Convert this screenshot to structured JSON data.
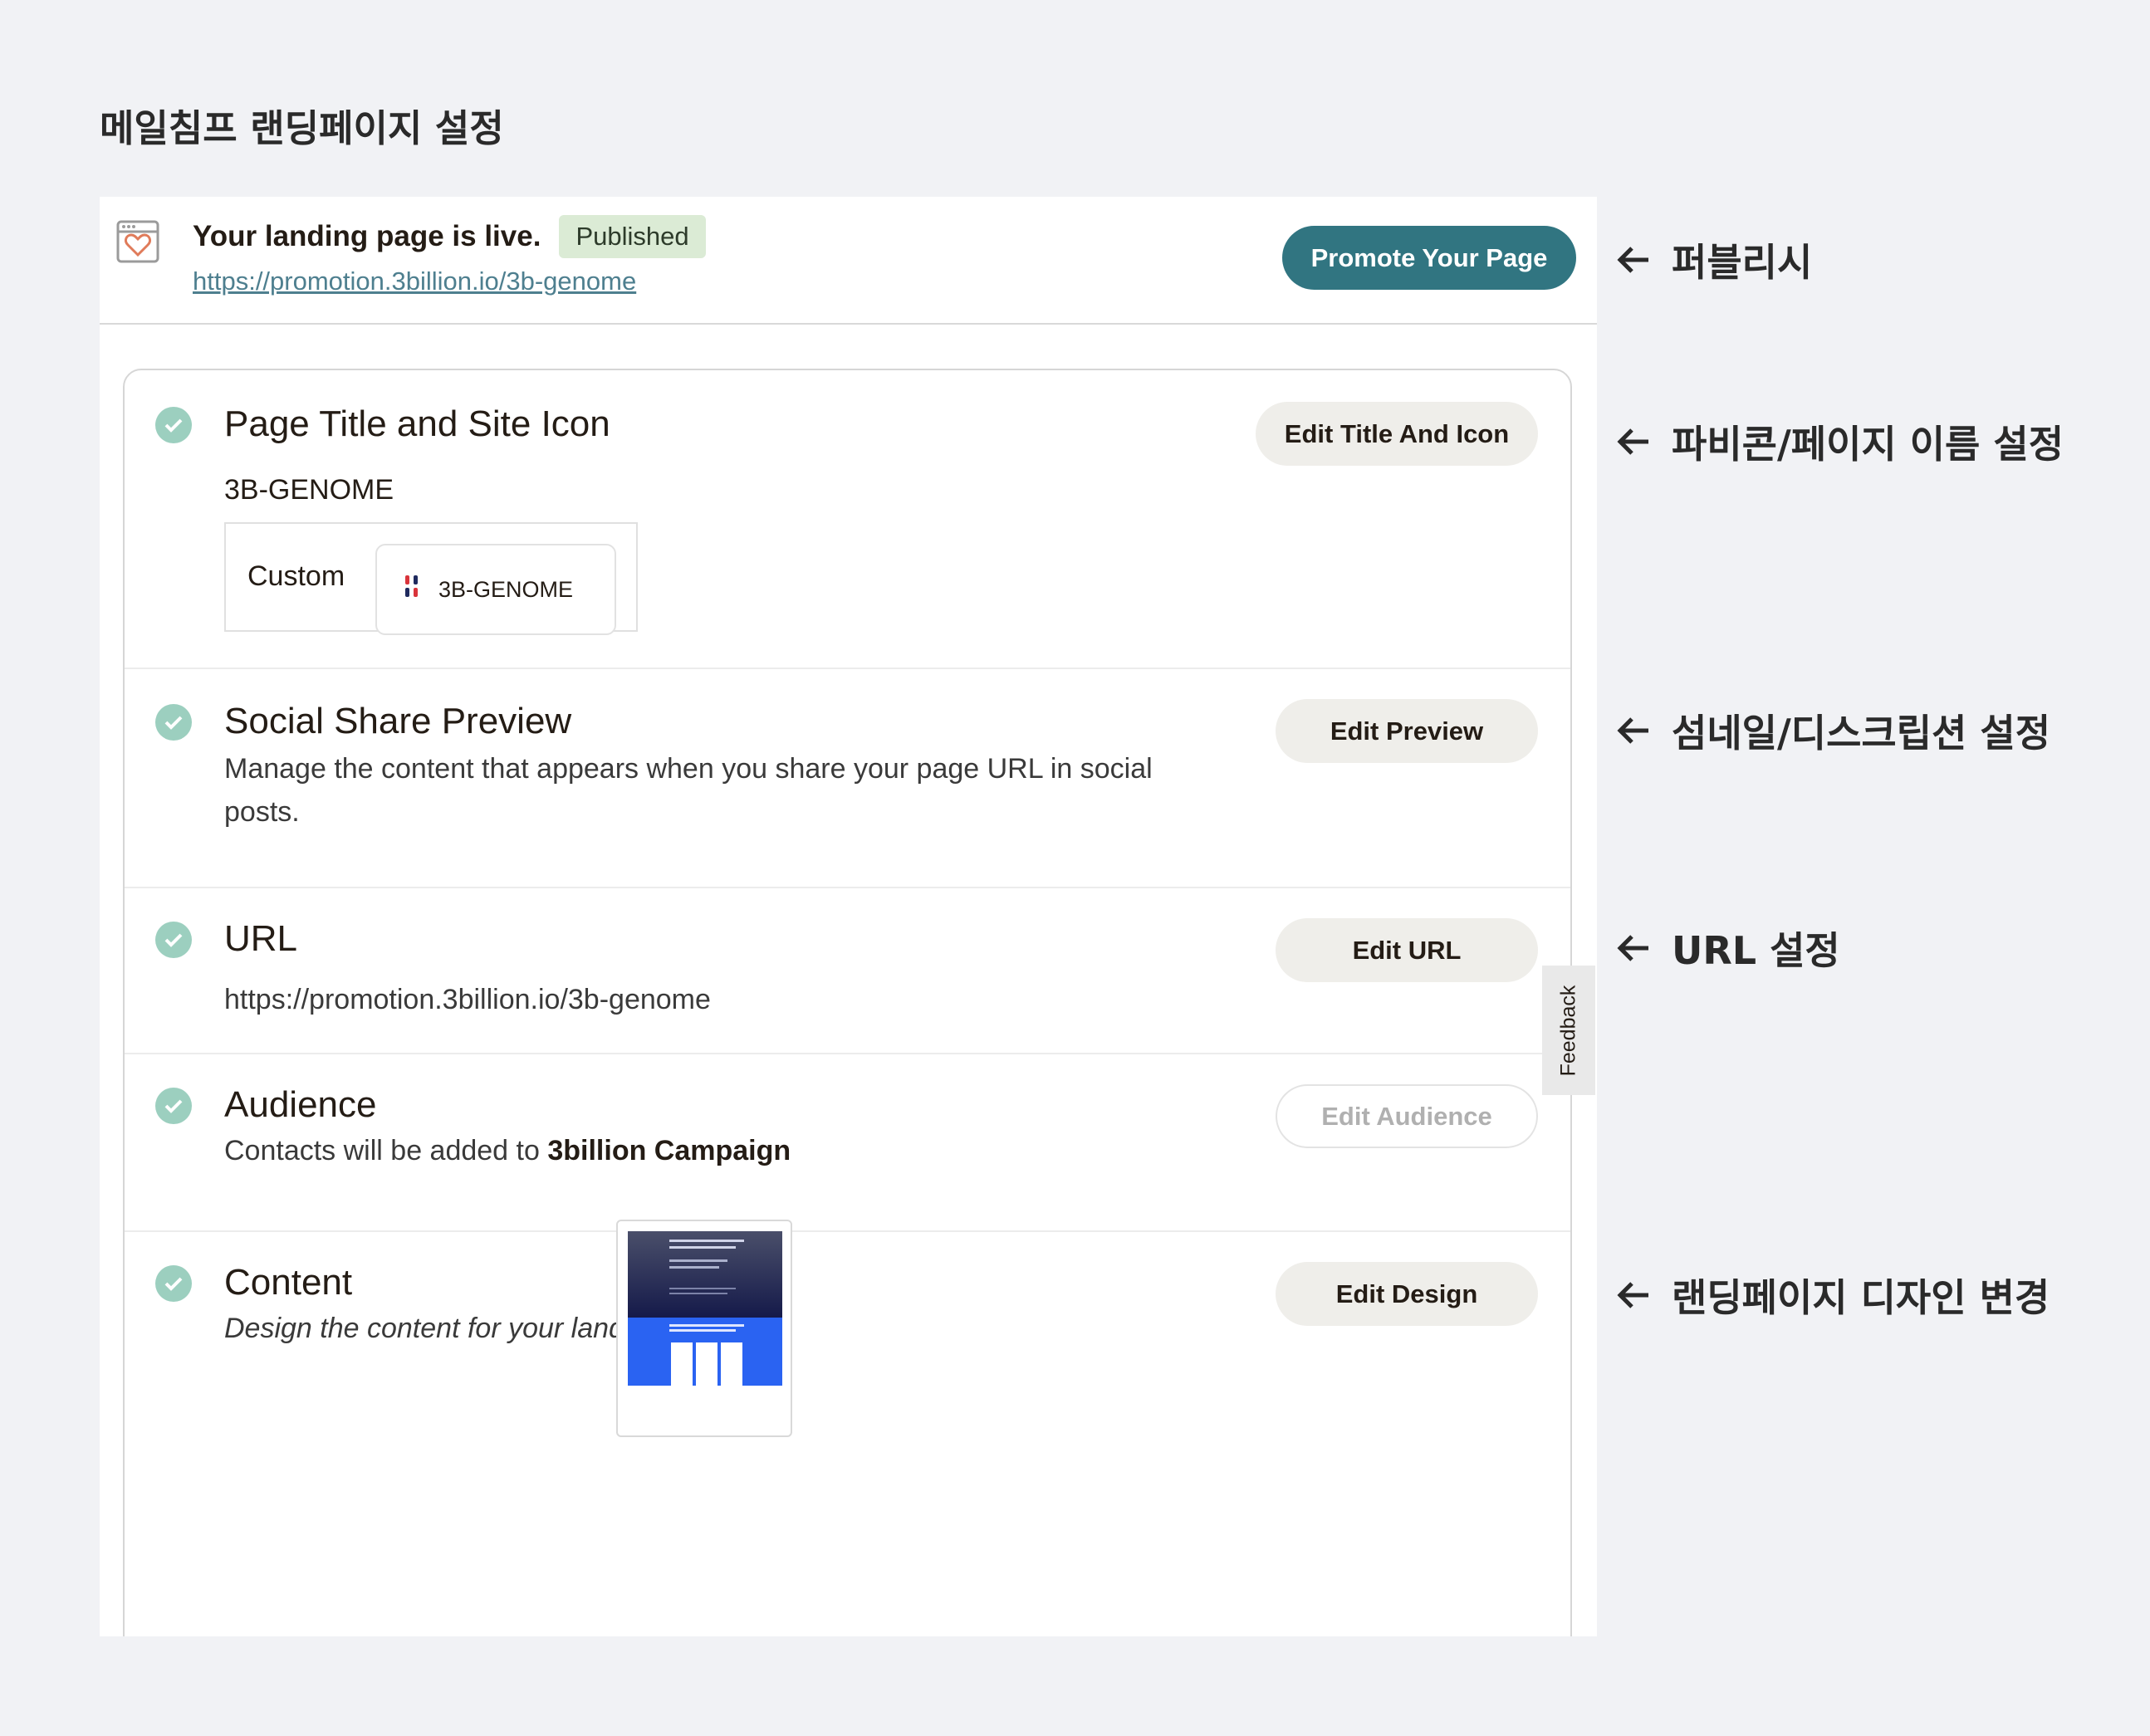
{
  "page": {
    "title": "메일침프 랜딩페이지 설정"
  },
  "status": {
    "live_text": "Your landing page is live.",
    "badge": "Published",
    "url": "https://promotion.3billion.io/3b-genome",
    "promote_label": "Promote Your Page"
  },
  "sections": {
    "title_icon": {
      "title": "Page Title and Site Icon",
      "value": "3B-GENOME",
      "custom_label": "Custom",
      "tab_name": "3B-GENOME",
      "button": "Edit Title And Icon"
    },
    "social": {
      "title": "Social Share Preview",
      "description": "Manage the content that appears when you share your page URL in social posts.",
      "button": "Edit Preview"
    },
    "url": {
      "title": "URL",
      "value": "https://promotion.3billion.io/3b-genome",
      "button": "Edit URL"
    },
    "audience": {
      "title": "Audience",
      "prefix": "Contacts will be added to",
      "name": "3billion Campaign",
      "button": "Edit Audience"
    },
    "content": {
      "title": "Content",
      "description": "Design the content for your landing page.",
      "button": "Edit Design"
    }
  },
  "feedback": {
    "label": "Feedback"
  },
  "annotations": {
    "publish": "퍼블리시",
    "favicon": "파비콘/페이지 이름 설정",
    "thumbnail": "섬네일/디스크립션 설정",
    "url": "URL 설정",
    "design": "랜딩페이지 디자인 변경"
  },
  "colors": {
    "primary": "#317581",
    "check": "#9ccfbf",
    "badge_bg": "#dbebd5",
    "link": "#4e7f8f",
    "background": "#f1f2f5"
  },
  "icons": {
    "status": "landing-page-heart-icon",
    "check": "checkmark-icon",
    "favicon": "3b-genome-favicon-icon",
    "arrow": "arrow-left-icon"
  }
}
